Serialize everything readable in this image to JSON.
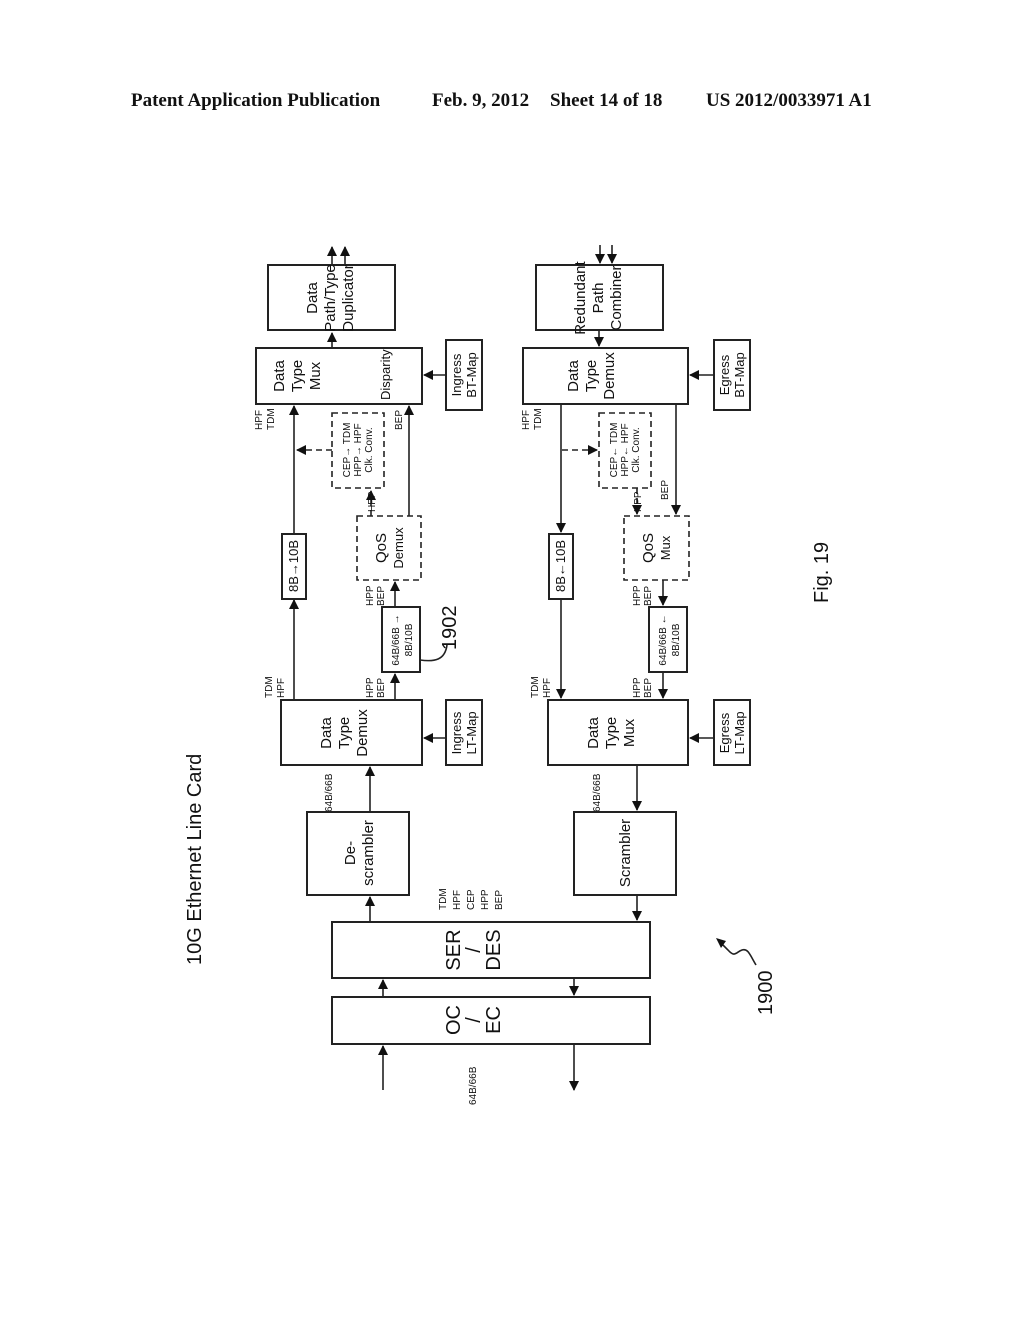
{
  "header": {
    "left": "Patent Application Publication",
    "date": "Feb. 9, 2012",
    "sheet": "Sheet 14 of 18",
    "number": "US 2012/0033971 A1"
  },
  "diagram": {
    "title": "10G Ethernet Line Card",
    "figure_label": "Fig. 19",
    "ref_main": "1900",
    "ref_converter": "1902",
    "ingress": {
      "data_path_duplicator": [
        "Data",
        "Path/Type",
        "Duplicator"
      ],
      "data_type_mux": [
        "Data",
        "Type",
        "Mux"
      ],
      "disparity": "Disparity",
      "ingress_bt_map": [
        "Ingress",
        "BT-Map"
      ],
      "clk_conv": [
        "CEP→ TDM",
        "HPP→ HPF",
        "Clk. Conv."
      ],
      "qos_demux": [
        "QoS",
        "Demux"
      ],
      "enc_8b10b": "8B→10B",
      "converter": [
        "64B/66B →",
        "8B/10B"
      ],
      "data_type_demux": [
        "Data",
        "Type",
        "Demux"
      ],
      "ingress_lt_map": [
        "Ingress",
        "LT-Map"
      ],
      "descrambler": [
        "De-",
        "scrambler"
      ]
    },
    "egress": {
      "redundant_path_combiner": [
        "Redundant",
        "Path",
        "Combiner"
      ],
      "data_type_demux": [
        "Data",
        "Type",
        "Demux"
      ],
      "egress_bt_map": [
        "Egress",
        "BT-Map"
      ],
      "clk_conv": [
        "CEP← TDM",
        "HPP← HPF",
        "Clk. Conv."
      ],
      "qos_mux": [
        "QoS",
        "Mux"
      ],
      "dec_8b10b": "8B←10B",
      "converter": [
        "64B/66B ←",
        "8B/10B"
      ],
      "data_type_mux": [
        "Data",
        "Type",
        "Mux"
      ],
      "egress_lt_map": [
        "Egress",
        "LT-Map"
      ],
      "scrambler": "Scrambler"
    },
    "serdes": [
      "SER",
      "/",
      "DES"
    ],
    "ocec": [
      "OC",
      "/",
      "EC"
    ],
    "labels": {
      "hpf": "HPF",
      "tdm": "TDM",
      "bep": "BEP",
      "hpp": "HPP",
      "enc64": "64B/66B",
      "types": [
        "TDM",
        "HPF",
        "CEP",
        "HPP",
        "BEP"
      ]
    }
  }
}
